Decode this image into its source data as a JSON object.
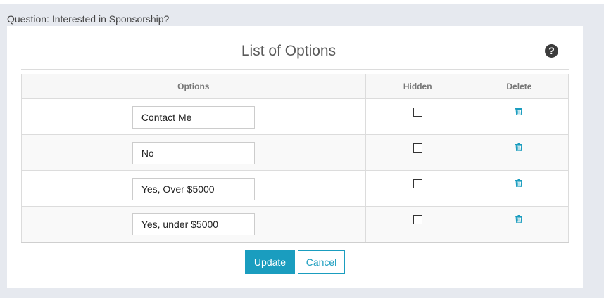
{
  "question_label": "Question: Interested in Sponsorship?",
  "modal": {
    "title": "List of Options",
    "help_glyph": "?",
    "columns": {
      "options": "Options",
      "hidden": "Hidden",
      "delete": "Delete"
    },
    "rows": [
      {
        "value": "Contact Me",
        "hidden": false
      },
      {
        "value": "No",
        "hidden": false
      },
      {
        "value": "Yes, Over $5000",
        "hidden": false
      },
      {
        "value": "Yes, under $5000",
        "hidden": false
      }
    ],
    "buttons": {
      "update": "Update",
      "cancel": "Cancel"
    }
  },
  "icons": {
    "help": "help-circle-icon",
    "delete": "trash-icon",
    "hidden": "checkbox-icon"
  },
  "colors": {
    "accent": "#1a9dbf",
    "background": "#e6e9ef",
    "help_icon": "#3c3c3c"
  }
}
